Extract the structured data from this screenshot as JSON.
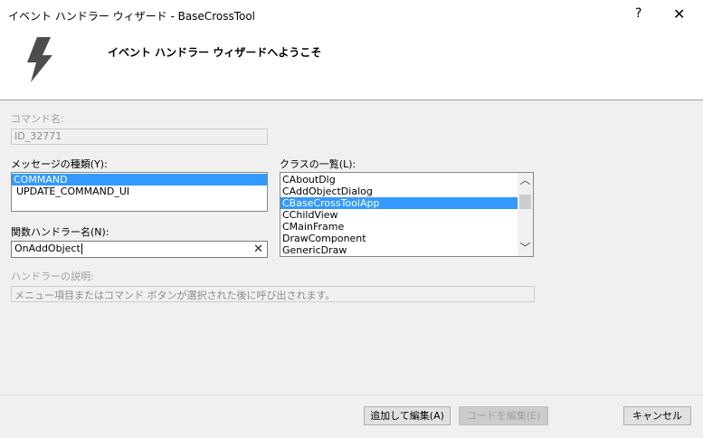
{
  "window": {
    "title": "イベント ハンドラー ウィザード - BaseCrossTool",
    "help_glyph": "?",
    "close_glyph": "✕"
  },
  "header": {
    "title": "イベント ハンドラー ウィザードへようこそ",
    "icon": "lightning-bolt-icon",
    "icon_color": "#4d4d4d"
  },
  "form": {
    "command_name": {
      "label": "コマンド名:",
      "value": "ID_32771"
    },
    "message_types": {
      "label": "メッセージの種類(Y):",
      "items": [
        "COMMAND",
        "UPDATE_COMMAND_UI"
      ],
      "selected_index": 0
    },
    "class_list": {
      "label": "クラスの一覧(L):",
      "items": [
        "CAboutDlg",
        "CAddObjectDialog",
        "CBaseCrossToolApp",
        "CChildView",
        "CMainFrame",
        "DrawComponent",
        "GenericDraw"
      ],
      "selected_index": 2,
      "scroll_up_glyph": "︿",
      "scroll_down_glyph": "﹀"
    },
    "handler_name": {
      "label": "関数ハンドラー名(N):",
      "value": "OnAddObject",
      "clear_glyph": "✕"
    },
    "handler_desc": {
      "label": "ハンドラーの説明:",
      "value": "メニュー項目またはコマンド ボタンが選択された後に呼び出されます。"
    }
  },
  "buttons": {
    "add_and_edit": "追加して編集(A)",
    "edit_code": "コードを編集(E)",
    "cancel": "キャンセル"
  },
  "colors": {
    "selection": "#3399ff",
    "dialog_bg": "#f0f0f0"
  }
}
